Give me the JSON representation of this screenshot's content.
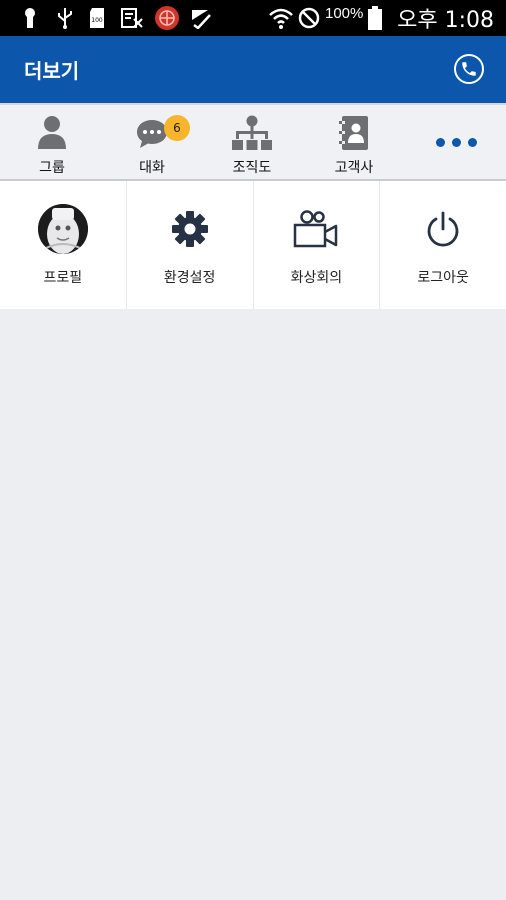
{
  "status_bar": {
    "battery_percent": "100%",
    "clock": "오후 1:08"
  },
  "app_bar": {
    "title": "더보기",
    "phone_icon": "phone-icon"
  },
  "tabs": [
    {
      "label": "그룹",
      "icon": "person-icon"
    },
    {
      "label": "대화",
      "icon": "chat-icon",
      "badge": "6"
    },
    {
      "label": "조직도",
      "icon": "org-chart-icon"
    },
    {
      "label": "고객사",
      "icon": "address-book-icon"
    },
    {
      "label": "",
      "icon": "more-icon"
    }
  ],
  "menu": [
    {
      "label": "프로필",
      "icon": "avatar"
    },
    {
      "label": "환경설정",
      "icon": "gear-icon"
    },
    {
      "label": "화상회의",
      "icon": "video-camera-icon"
    },
    {
      "label": "로그아웃",
      "icon": "power-icon"
    }
  ],
  "colors": {
    "primary": "#0c56ab",
    "badge": "#f7b52b",
    "icon_gray": "#6d6f73",
    "icon_dark": "#273244"
  }
}
